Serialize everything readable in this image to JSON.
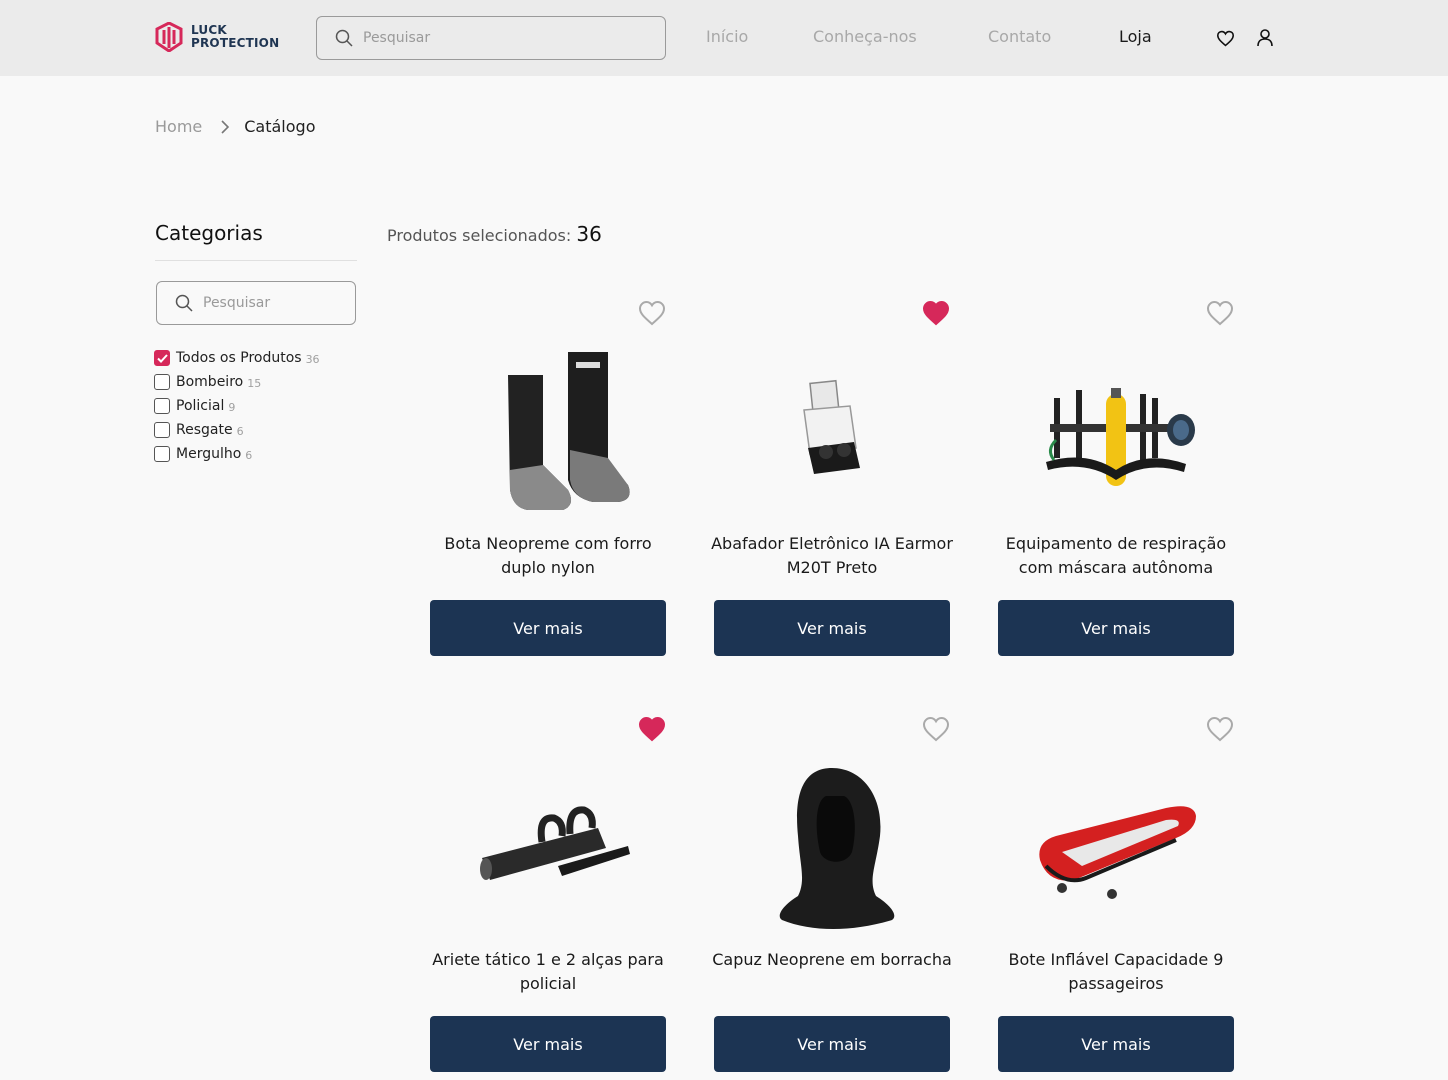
{
  "brand": {
    "line1": "LUCK",
    "line2": "PROTECTION",
    "accent": "#d6285a",
    "navy": "#1c3453"
  },
  "header": {
    "search_placeholder": "Pesquisar"
  },
  "nav": {
    "items": [
      {
        "label": "Início"
      },
      {
        "label": "Conheça-nos"
      },
      {
        "label": "Contato"
      },
      {
        "label": "Loja"
      }
    ]
  },
  "header_icons": {
    "favorites": "heart-icon",
    "account": "user-icon"
  },
  "breadcrumb": {
    "home": "Home",
    "current": "Catálogo"
  },
  "sidebar": {
    "title": "Categorias",
    "search_placeholder": "Pesquisar",
    "categories": [
      {
        "label": "Todos os Produtos",
        "count": "36",
        "checked": true
      },
      {
        "label": "Bombeiro",
        "count": "15",
        "checked": false
      },
      {
        "label": "Policial",
        "count": "9",
        "checked": false
      },
      {
        "label": "Resgate",
        "count": "6",
        "checked": false
      },
      {
        "label": "Mergulho",
        "count": "6",
        "checked": false
      }
    ]
  },
  "results": {
    "label": "Produtos selecionados:",
    "count": "36"
  },
  "products": [
    {
      "name": "Bota Neopreme com forro duplo nylon",
      "button": "Ver mais",
      "favorited": false,
      "image": "boots"
    },
    {
      "name": "Abafador Eletrônico IA Earmor M20T Preto",
      "button": "Ver mais",
      "favorited": true,
      "image": "earplugs"
    },
    {
      "name": "Equipamento de respiração com máscara autônoma",
      "button": "Ver mais",
      "favorited": false,
      "image": "breathing-apparatus"
    },
    {
      "name": "Ariete tático 1 e 2 alças para policial",
      "button": "Ver mais",
      "favorited": true,
      "image": "battering-ram"
    },
    {
      "name": "Capuz Neoprene em borracha",
      "button": "Ver mais",
      "favorited": false,
      "image": "neoprene-hood"
    },
    {
      "name": "Bote Inflável Capacidade 9 passageiros",
      "button": "Ver mais",
      "favorited": false,
      "image": "inflatable-boat"
    }
  ]
}
